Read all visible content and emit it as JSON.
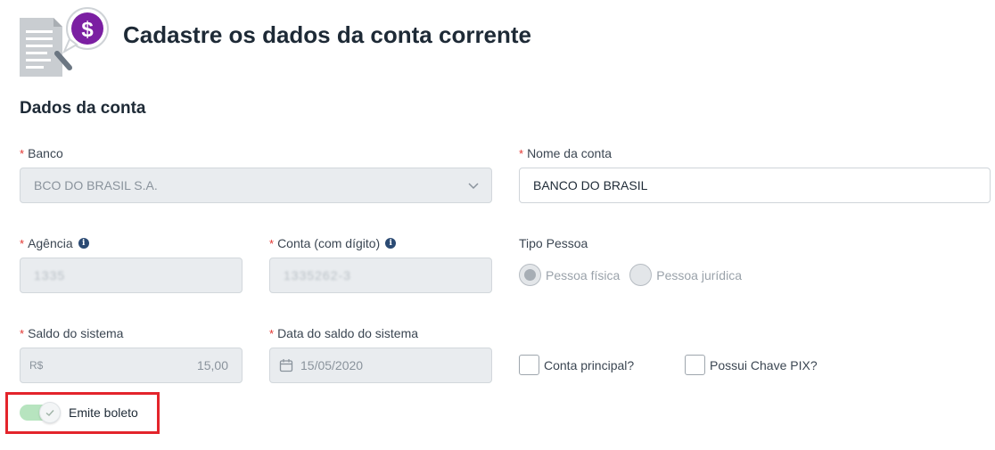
{
  "header": {
    "title": "Cadastre os dados da conta corrente",
    "icon": "document-money-search-icon"
  },
  "section": {
    "title": "Dados da conta"
  },
  "form": {
    "required_marker": "*",
    "banco": {
      "label": "Banco",
      "value": "BCO DO BRASIL S.A."
    },
    "nome_conta": {
      "label": "Nome da conta",
      "value": "BANCO DO BRASIL"
    },
    "agencia": {
      "label": "Agência",
      "value": "1335"
    },
    "conta": {
      "label": "Conta (com dígito)",
      "value": "1335262-3"
    },
    "tipo_pessoa": {
      "label": "Tipo Pessoa",
      "options": [
        "Pessoa física",
        "Pessoa jurídica"
      ],
      "selected": "Pessoa física"
    },
    "saldo": {
      "label": "Saldo do sistema",
      "currency": "R$",
      "value": "15,00"
    },
    "data_saldo": {
      "label": "Data do saldo do sistema",
      "value": "15/05/2020"
    },
    "conta_principal": {
      "label": "Conta principal?",
      "checked": false
    },
    "chave_pix": {
      "label": "Possui Chave PIX?",
      "checked": false
    },
    "emite_boleto": {
      "label": "Emite boleto",
      "checked": true
    }
  },
  "colors": {
    "required": "#e3342f",
    "toggle_on": "#b7e4bf",
    "highlight_box": "#e3242b",
    "accent_purple": "#7b1fa2"
  }
}
